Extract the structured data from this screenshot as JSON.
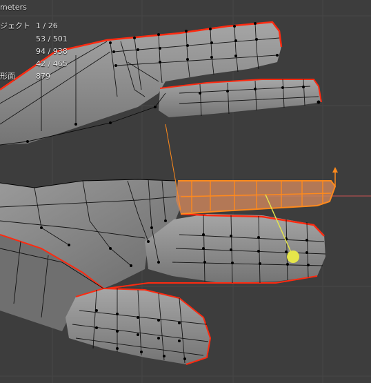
{
  "viewport": {
    "units_label": "meters",
    "stats": [
      {
        "label": "ジェクト",
        "value": "1 / 26"
      },
      {
        "label": "",
        "value": "53 / 501"
      },
      {
        "label": "",
        "value": "94 / 938"
      },
      {
        "label": "",
        "value": "42 / 465"
      },
      {
        "label": "形面",
        "value": "879"
      }
    ],
    "colors": {
      "background": "#3d3d3d",
      "grid": "#474747",
      "mesh_fill": "#8a8a8a",
      "edge": "#000000",
      "seam": "#ff2a10",
      "selection": "#ff8a1c",
      "gizmo": "#e6e64a"
    }
  }
}
